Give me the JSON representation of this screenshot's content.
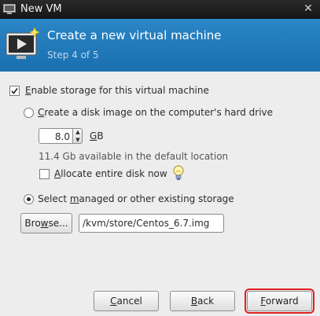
{
  "window": {
    "title": "New VM"
  },
  "banner": {
    "heading": "Create a new virtual machine",
    "step": "Step 4 of 5"
  },
  "storage": {
    "enable_label_mnemonic": "E",
    "enable_label_rest": "nable storage for this virtual machine",
    "enable_checked": true,
    "create_disk": {
      "label_mnemonic": "C",
      "label_rest": "reate a disk image on the computer's hard drive",
      "selected": false,
      "size_value": "8.0",
      "unit_mnemonic": "G",
      "unit_rest": "B",
      "available_text": "11.4 Gb available in the default location",
      "allocate_mnemonic": "A",
      "allocate_rest": "llocate entire disk now",
      "allocate_checked": false
    },
    "existing": {
      "label_prefix": "Select ",
      "label_mnemonic": "m",
      "label_rest": "anaged or other existing storage",
      "selected": true,
      "browse_mnemonic": "w",
      "browse_prefix": "Bro",
      "browse_rest": "se...",
      "path_value": "/kvm/store/Centos_6.7.img"
    }
  },
  "buttons": {
    "cancel_mnemonic": "C",
    "cancel_rest": "ancel",
    "back_mnemonic": "B",
    "back_rest": "ack",
    "forward_mnemonic": "F",
    "forward_rest": "orward"
  },
  "icons": {
    "app": "vm-window-icon",
    "banner": "new-vm-monitor-icon",
    "close": "close-icon",
    "hint": "lightbulb-icon"
  },
  "colors": {
    "banner": "#1f78b9",
    "highlight": "#e02020"
  }
}
